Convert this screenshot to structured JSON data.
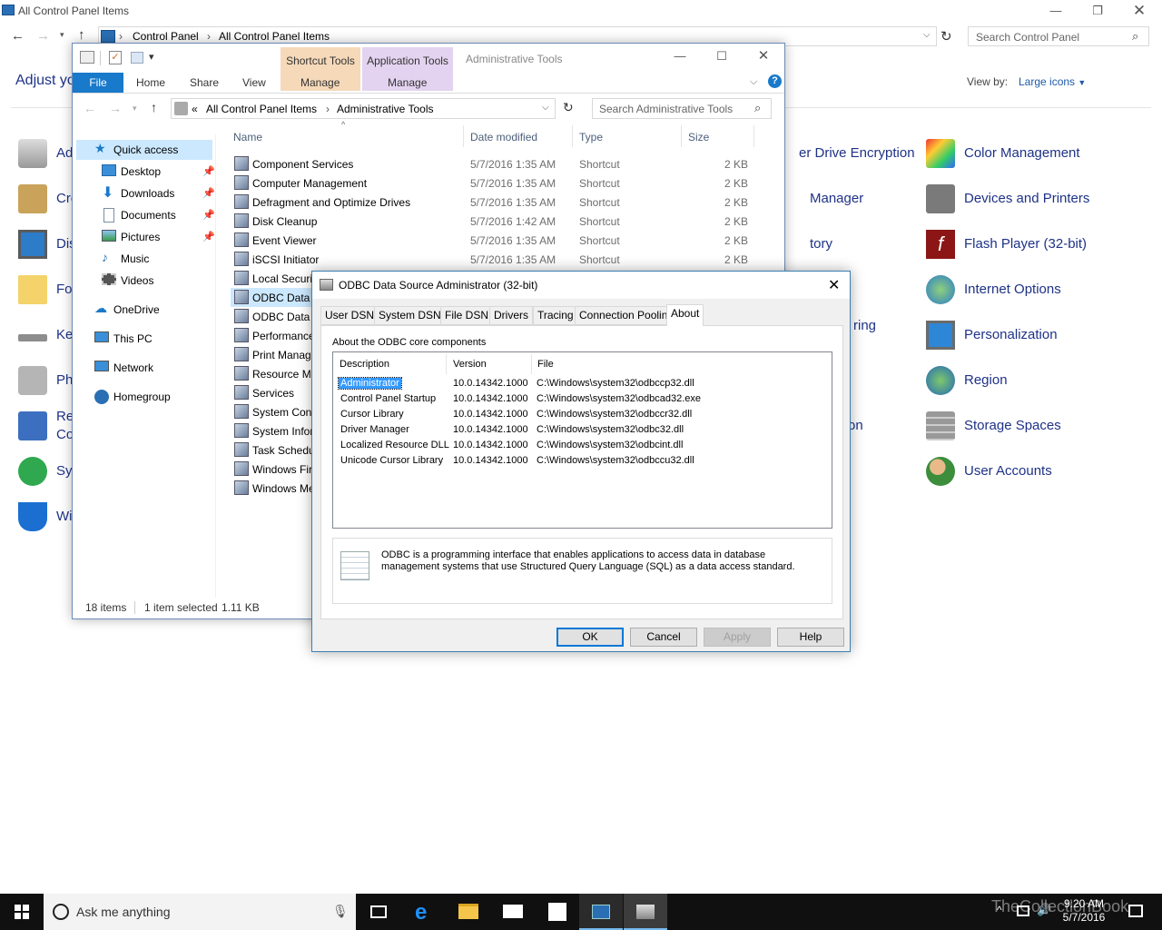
{
  "control_panel": {
    "title": "All Control Panel Items",
    "breadcrumb": [
      "Control Panel",
      "All Control Panel Items"
    ],
    "search_placeholder": "Search Control Panel",
    "heading": "Adjust yo",
    "view_by_label": "View by:",
    "view_by_value": "Large icons",
    "left_items": [
      "Ad",
      "Cre",
      "Dis",
      "Fo",
      "Ke",
      "Ph",
      "Re",
      "Co",
      "Sy",
      "Wi"
    ],
    "middle_items": [
      "er Drive Encryption",
      "Manager",
      "tory",
      "ring",
      "on"
    ],
    "right_items": [
      "Color Management",
      "Devices and Printers",
      "Flash Player (32-bit)",
      "Internet Options",
      "Personalization",
      "Region",
      "Storage Spaces",
      "User Accounts"
    ]
  },
  "explorer": {
    "context_tabs": [
      {
        "group": "Shortcut Tools",
        "tab": "Manage",
        "color": "#f6d9b9"
      },
      {
        "group": "Application Tools",
        "tab": "Manage",
        "color": "#e3d3f0"
      }
    ],
    "title": "Administrative Tools",
    "ribbon_tabs": [
      "File",
      "Home",
      "Share",
      "View"
    ],
    "breadcrumb": [
      "«",
      "All Control Panel Items",
      "Administrative Tools"
    ],
    "search_placeholder": "Search Administrative Tools",
    "nav": [
      {
        "label": "Quick access",
        "icon": "star-icon"
      },
      {
        "label": "Desktop",
        "icon": "desktop-icon",
        "pinned": true
      },
      {
        "label": "Downloads",
        "icon": "download-icon",
        "pinned": true
      },
      {
        "label": "Documents",
        "icon": "documents-icon",
        "pinned": true
      },
      {
        "label": "Pictures",
        "icon": "pictures-icon",
        "pinned": true
      },
      {
        "label": "Music",
        "icon": "music-icon"
      },
      {
        "label": "Videos",
        "icon": "videos-icon"
      },
      {
        "label": "OneDrive",
        "icon": "cloud-icon"
      },
      {
        "label": "This PC",
        "icon": "computer-icon"
      },
      {
        "label": "Network",
        "icon": "network-icon"
      },
      {
        "label": "Homegroup",
        "icon": "homegroup-icon"
      }
    ],
    "columns": [
      "Name",
      "Date modified",
      "Type",
      "Size"
    ],
    "files": [
      {
        "name": "Component Services",
        "date": "5/7/2016 1:35 AM",
        "type": "Shortcut",
        "size": "2 KB"
      },
      {
        "name": "Computer Management",
        "date": "5/7/2016 1:35 AM",
        "type": "Shortcut",
        "size": "2 KB"
      },
      {
        "name": "Defragment and Optimize Drives",
        "date": "5/7/2016 1:35 AM",
        "type": "Shortcut",
        "size": "2 KB"
      },
      {
        "name": "Disk Cleanup",
        "date": "5/7/2016 1:42 AM",
        "type": "Shortcut",
        "size": "2 KB"
      },
      {
        "name": "Event Viewer",
        "date": "5/7/2016 1:35 AM",
        "type": "Shortcut",
        "size": "2 KB"
      },
      {
        "name": "iSCSI Initiator",
        "date": "5/7/2016 1:35 AM",
        "type": "Shortcut",
        "size": "2 KB"
      },
      {
        "name": "Local Securi",
        "date": "",
        "type": "",
        "size": ""
      },
      {
        "name": "ODBC Data S",
        "date": "",
        "type": "",
        "size": ""
      },
      {
        "name": "ODBC Data S",
        "date": "",
        "type": "",
        "size": ""
      },
      {
        "name": "Performance",
        "date": "",
        "type": "",
        "size": ""
      },
      {
        "name": "Print Manag",
        "date": "",
        "type": "",
        "size": ""
      },
      {
        "name": "Resource Mo",
        "date": "",
        "type": "",
        "size": ""
      },
      {
        "name": "Services",
        "date": "",
        "type": "",
        "size": ""
      },
      {
        "name": "System Cont",
        "date": "",
        "type": "",
        "size": ""
      },
      {
        "name": "System Infor",
        "date": "",
        "type": "",
        "size": ""
      },
      {
        "name": "Task Schedu",
        "date": "",
        "type": "",
        "size": ""
      },
      {
        "name": "Windows Fir",
        "date": "",
        "type": "",
        "size": ""
      },
      {
        "name": "Windows Me",
        "date": "",
        "type": "",
        "size": ""
      }
    ],
    "status_count": "18 items",
    "status_selected": "1 item selected",
    "status_size": "1.11 KB"
  },
  "odbc": {
    "title": "ODBC Data Source Administrator (32-bit)",
    "tabs": [
      "User DSN",
      "System DSN",
      "File DSN",
      "Drivers",
      "Tracing",
      "Connection Pooling",
      "About"
    ],
    "active_tab": "About",
    "section_label": "About the ODBC core components",
    "columns": [
      "Description",
      "Version",
      "File"
    ],
    "components": [
      {
        "description": "Administrator",
        "version": "10.0.14342.1000",
        "file": "C:\\Windows\\system32\\odbccp32.dll"
      },
      {
        "description": "Control Panel Startup",
        "version": "10.0.14342.1000",
        "file": "C:\\Windows\\system32\\odbcad32.exe"
      },
      {
        "description": "Cursor Library",
        "version": "10.0.14342.1000",
        "file": "C:\\Windows\\system32\\odbccr32.dll"
      },
      {
        "description": "Driver Manager",
        "version": "10.0.14342.1000",
        "file": "C:\\Windows\\system32\\odbc32.dll"
      },
      {
        "description": "Localized Resource DLL",
        "version": "10.0.14342.1000",
        "file": "C:\\Windows\\system32\\odbcint.dll"
      },
      {
        "description": "Unicode Cursor Library",
        "version": "10.0.14342.1000",
        "file": "C:\\Windows\\system32\\odbccu32.dll"
      }
    ],
    "info_text": "ODBC is a programming interface that enables applications to access data in database management systems that use Structured Query Language (SQL) as a data access standard.",
    "buttons": {
      "ok": "OK",
      "cancel": "Cancel",
      "apply": "Apply",
      "help": "Help"
    }
  },
  "taskbar": {
    "search_placeholder": "Ask me anything",
    "time": "9:20 AM",
    "date": "5/7/2016",
    "watermark": "TheCollectionBook"
  }
}
